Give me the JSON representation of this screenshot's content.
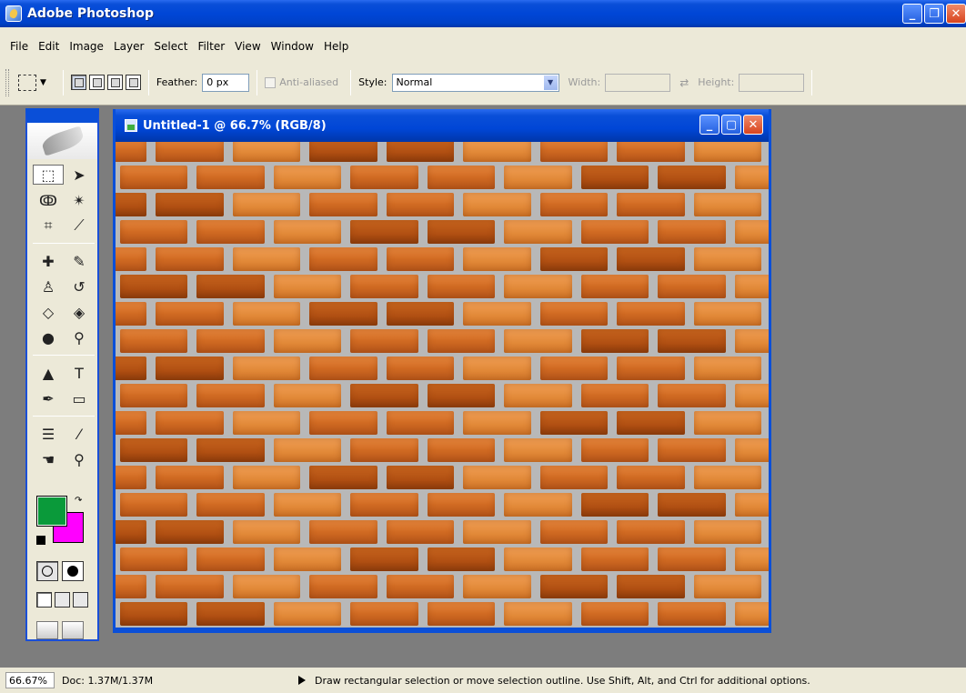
{
  "app": {
    "title": "Adobe Photoshop"
  },
  "menu": [
    "File",
    "Edit",
    "Image",
    "Layer",
    "Select",
    "Filter",
    "View",
    "Window",
    "Help"
  ],
  "options": {
    "feather_label": "Feather:",
    "feather_value": "0 px",
    "antialiased_label": "Anti-aliased",
    "style_label": "Style:",
    "style_value": "Normal",
    "width_label": "Width:",
    "height_label": "Height:"
  },
  "document": {
    "title": "Untitled-1 @ 66.7% (RGB/8)"
  },
  "colors": {
    "foreground": "#0a9a3a",
    "background": "#ff00ff",
    "title_blue": "#0a4fd8"
  },
  "tools": [
    "rectangular-marquee-icon",
    "move-icon",
    "lasso-icon",
    "magic-wand-icon",
    "crop-icon",
    "slice-icon",
    "healing-brush-icon",
    "brush-icon",
    "clone-stamp-icon",
    "history-brush-icon",
    "eraser-icon",
    "paint-bucket-icon",
    "blur-icon",
    "dodge-icon",
    "path-selection-icon",
    "type-icon",
    "pen-icon",
    "rectangle-shape-icon",
    "notes-icon",
    "eyedropper-icon",
    "hand-icon",
    "zoom-icon"
  ],
  "status": {
    "zoom": "66.67%",
    "doc": "Doc: 1.37M/1.37M",
    "message": "Draw rectangular selection or move selection outline.  Use Shift, Alt, and Ctrl for additional options."
  }
}
